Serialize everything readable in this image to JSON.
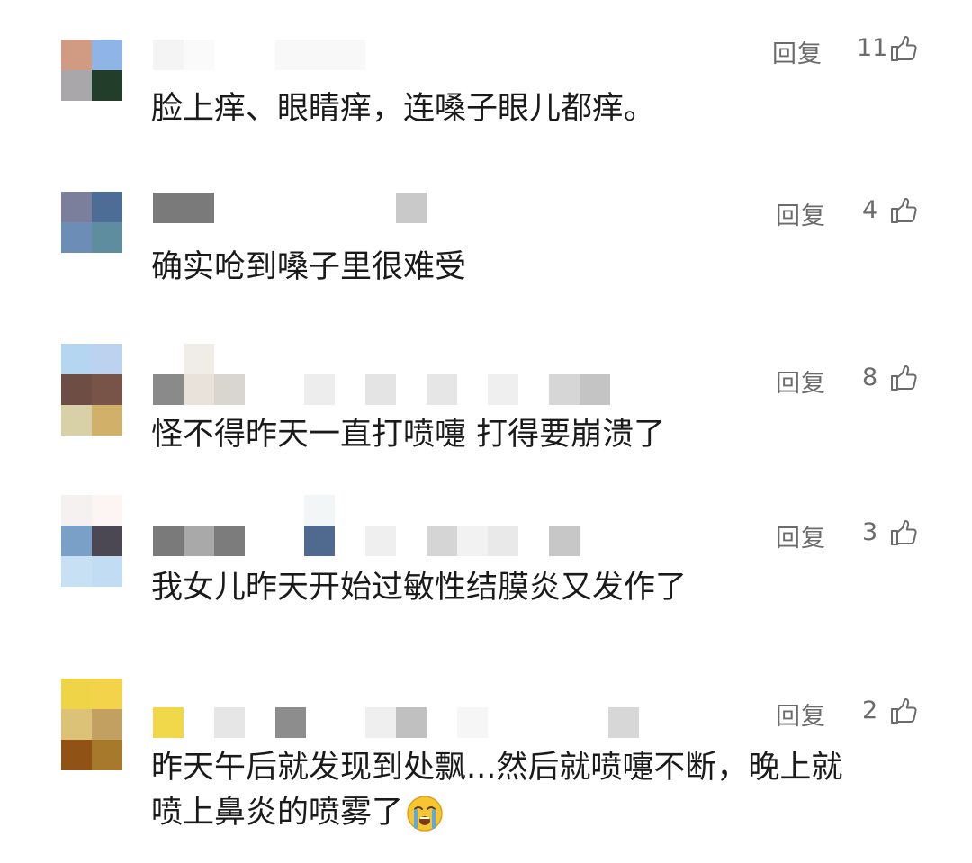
{
  "comments": [
    {
      "reply_label": "回复",
      "likes": "11",
      "text": "脸上痒、眼睛痒，连嗓子眼儿都痒。",
      "avatar_colors": [
        "#d19a82",
        "#8fb4e6",
        "#a9a7a9",
        "#233d2b"
      ]
    },
    {
      "reply_label": "回复",
      "likes": "4",
      "text": "确实呛到嗓子里很难受",
      "avatar_colors": [
        "#7b7f9c",
        "#4d6c96",
        "#6b8db6",
        "#5e8da0"
      ]
    },
    {
      "reply_label": "回复",
      "likes": "8",
      "text": "怪不得昨天一直打喷嚏 打得要崩溃了",
      "avatar_colors": [
        "#b5d6f1",
        "#bcd2ef",
        "#6e4e44",
        "#775447",
        "#d8d0a6",
        "#d1b06a"
      ]
    },
    {
      "reply_label": "回复",
      "likes": "3",
      "text": "我女儿昨天开始过敏性结膜炎又发作了",
      "avatar_colors": [
        "#f6f1f1",
        "#fcf5f4",
        "#7aa0c8",
        "#4b4753",
        "#c8e0f4",
        "#c1dcf3"
      ]
    },
    {
      "reply_label": "回复",
      "likes": "2",
      "text_line1": "昨天午后就发现到处飘...然后就喷嚏不断，晚上就",
      "text_line2": "喷上鼻炎的喷雾了",
      "emoji": "crying-face",
      "avatar_colors": [
        "#f0d447",
        "#f3d34a",
        "#dcc277",
        "#c1a061",
        "#915315",
        "#a77a2b"
      ]
    }
  ],
  "accent_color": "#6b6b6b"
}
